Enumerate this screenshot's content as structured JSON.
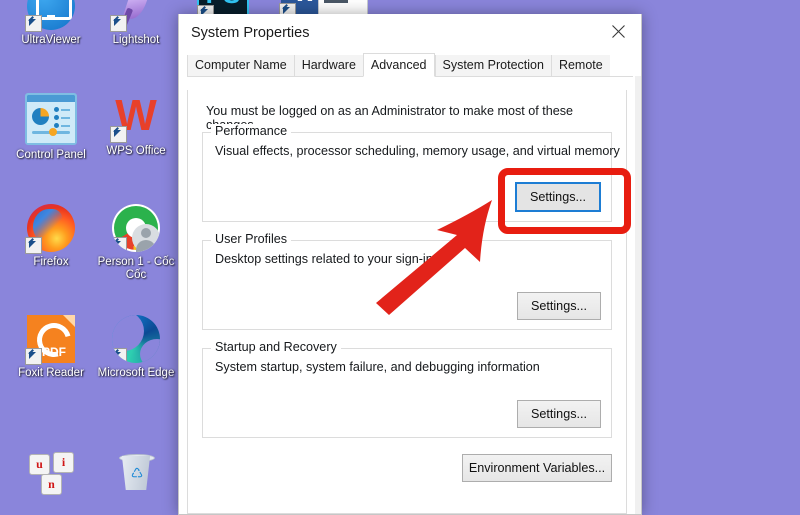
{
  "desktop": {
    "background_color": "#8a85db",
    "icons": [
      {
        "label": "UltraViewer",
        "icon": "ultraviewer-icon",
        "shortcut": true
      },
      {
        "label": "Lightshot",
        "icon": "lightshot-icon",
        "shortcut": true
      },
      {
        "label": "Control Panel",
        "icon": "control-panel-icon",
        "shortcut": false
      },
      {
        "label": "WPS Office",
        "icon": "wps-office-icon",
        "shortcut": true
      },
      {
        "label": "Firefox",
        "icon": "firefox-icon",
        "shortcut": true
      },
      {
        "label": "Person 1 - Cốc Cốc",
        "icon": "coccoc-browser-icon",
        "shortcut": true
      },
      {
        "label": "Foxit Reader",
        "icon": "foxit-reader-icon",
        "shortcut": true
      },
      {
        "label": "Microsoft Edge",
        "icon": "microsoft-edge-icon",
        "shortcut": true
      },
      {
        "label": "",
        "icon": "unikey-icon",
        "shortcut": false
      },
      {
        "label": "",
        "icon": "recycle-bin-icon",
        "shortcut": false
      }
    ],
    "partial_icons": [
      {
        "icon": "photoshop-icon",
        "glyph": "PS"
      },
      {
        "icon": "word-icon",
        "glyph": "W"
      },
      {
        "icon": "document-icon",
        "glyph": ""
      },
      {
        "icon": "word-edge-icon",
        "glyph": "W"
      }
    ]
  },
  "dialog": {
    "title": "System Properties",
    "close_label": "close-icon",
    "tabs": [
      {
        "label": "Computer Name",
        "active": false
      },
      {
        "label": "Hardware",
        "active": false
      },
      {
        "label": "Advanced",
        "active": true
      },
      {
        "label": "System Protection",
        "active": false
      },
      {
        "label": "Remote",
        "active": false
      }
    ],
    "notice": "You must be logged on as an Administrator to make most of these changes.",
    "groups": [
      {
        "legend": "Performance",
        "description": "Visual effects, processor scheduling, memory usage, and virtual memory",
        "button_label": "Settings...",
        "focused": true
      },
      {
        "legend": "User Profiles",
        "description": "Desktop settings related to your sign-in",
        "button_label": "Settings...",
        "focused": false
      },
      {
        "legend": "Startup and Recovery",
        "description": "System startup, system failure, and debugging information",
        "button_label": "Settings...",
        "focused": false
      }
    ],
    "environment_button_label": "Environment Variables..."
  },
  "annotation": {
    "highlight_color": "#e81d10",
    "arrow_color": "#e2231a",
    "target": "Settings..."
  }
}
